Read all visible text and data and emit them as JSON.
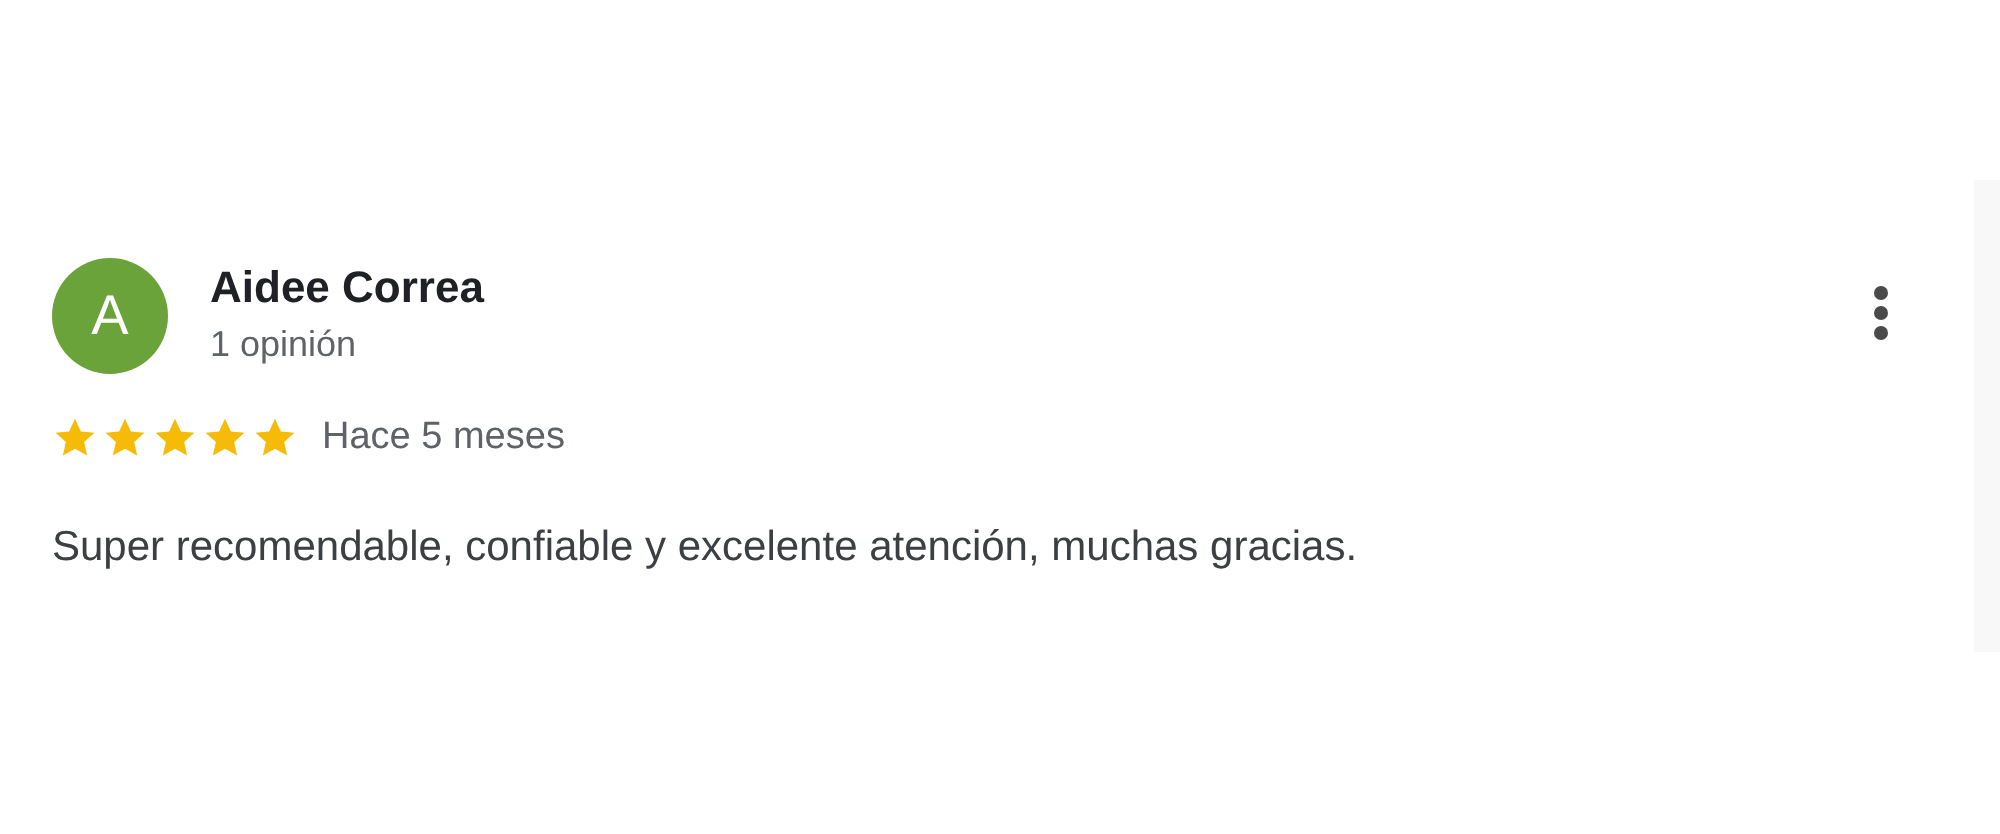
{
  "review": {
    "avatar_letter": "A",
    "author": "Aidee Correa",
    "review_count": "1 opinión",
    "stars": 5,
    "time": "Hace 5 meses",
    "text": "Super recomendable, confiable y excelente atención, muchas gracias."
  }
}
